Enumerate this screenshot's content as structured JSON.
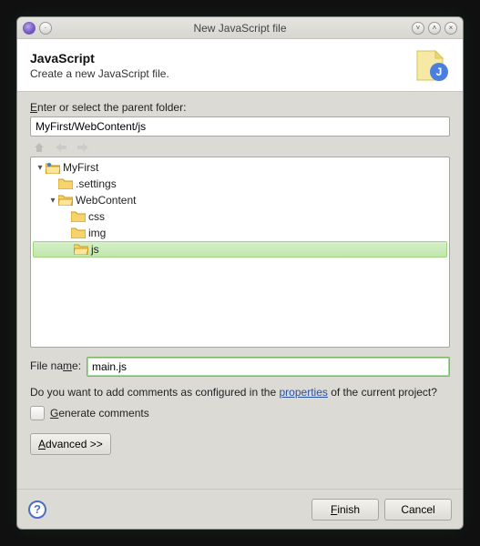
{
  "window": {
    "title": "New JavaScript file"
  },
  "banner": {
    "heading": "JavaScript",
    "description": "Create a new JavaScript file."
  },
  "parentFolder": {
    "label": "Enter or select the parent folder:",
    "label_ul": "E",
    "value": "MyFirst/WebContent/js"
  },
  "tree": {
    "project": "MyFirst",
    "settings": ".settings",
    "webcontent": "WebContent",
    "css": "css",
    "img": "img",
    "js": "js"
  },
  "filename": {
    "label": "File name:",
    "label_ul": "m",
    "value": "main.js"
  },
  "commentsLine": {
    "pre": "Do you want to add comments as configured in the ",
    "link": "properties",
    "post": " of the current project?"
  },
  "generate": {
    "label": "Generate comments",
    "label_ul": "G"
  },
  "advanced": {
    "label": "Advanced >>",
    "label_ul": "A"
  },
  "footer": {
    "finish": "Finish",
    "finish_ul": "F",
    "cancel": "Cancel"
  }
}
